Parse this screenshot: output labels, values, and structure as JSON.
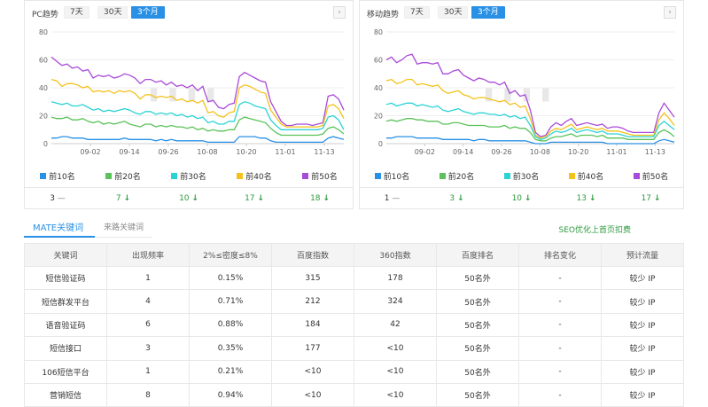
{
  "colors": {
    "accent": "#2a90e5",
    "green": "#2c9a3c",
    "series": [
      "#2a90e5",
      "#5ac25a",
      "#2cd3d6",
      "#f4c21b",
      "#a94bd9"
    ]
  },
  "pc": {
    "title": "PC趋势",
    "ranges": [
      "7天",
      "30天",
      "3个月"
    ],
    "legend": [
      "前10名",
      "前20名",
      "前30名",
      "前40名",
      "前50名"
    ],
    "counts": [
      {
        "value": "3",
        "trend": "flat"
      },
      {
        "value": "7",
        "trend": "down"
      },
      {
        "value": "10",
        "trend": "down"
      },
      {
        "value": "17",
        "trend": "down"
      },
      {
        "value": "18",
        "trend": "down"
      }
    ]
  },
  "mobile": {
    "title": "移动趋势",
    "ranges": [
      "7天",
      "30天",
      "3个月"
    ],
    "legend": [
      "前10名",
      "前20名",
      "前30名",
      "前40名",
      "前50名"
    ],
    "counts": [
      {
        "value": "1",
        "trend": "flat"
      },
      {
        "value": "3",
        "trend": "down"
      },
      {
        "value": "10",
        "trend": "down"
      },
      {
        "value": "13",
        "trend": "down"
      },
      {
        "value": "17",
        "trend": "down"
      }
    ]
  },
  "icons": {
    "flat": "—",
    "down": "↓",
    "next": "›"
  },
  "tabs": {
    "mate": "MATE关键词",
    "source": "来路关键词",
    "seo_link": "SEO优化上首页扣费"
  },
  "table": {
    "headers": [
      "关键词",
      "出现频率",
      "2%≤密度≤8%",
      "百度指数",
      "360指数",
      "百度排名",
      "排名变化",
      "预计流量"
    ],
    "rows": [
      [
        "短信验证码",
        "1",
        "0.15%",
        "315",
        "178",
        "50名外",
        "-",
        "较少 IP"
      ],
      [
        "短信群发平台",
        "4",
        "0.71%",
        "212",
        "324",
        "50名外",
        "-",
        "较少 IP"
      ],
      [
        "语音验证码",
        "6",
        "0.88%",
        "184",
        "42",
        "50名外",
        "-",
        "较少 IP"
      ],
      [
        "短信接口",
        "3",
        "0.35%",
        "177",
        "<10",
        "50名外",
        "-",
        "较少 IP"
      ],
      [
        "106短信平台",
        "1",
        "0.21%",
        "<10",
        "<10",
        "50名外",
        "-",
        "较少 IP"
      ],
      [
        "营销短信",
        "8",
        "0.94%",
        "<10",
        "<10",
        "50名外",
        "-",
        "较少 IP"
      ]
    ]
  },
  "chart_data": [
    {
      "type": "line",
      "x_ticks": [
        "09-02",
        "09-14",
        "09-26",
        "10-08",
        "10-20",
        "11-01",
        "11-13"
      ],
      "y_ticks": [
        "0",
        "20",
        "40",
        "60",
        "80"
      ],
      "ylim": [
        0,
        80
      ],
      "grid": true,
      "legend_position": "bottom",
      "series": [
        {
          "name": "前50名",
          "values": [
            62,
            59,
            56,
            57,
            54,
            55,
            52,
            53,
            47,
            49,
            48,
            49,
            47,
            48,
            50,
            49,
            47,
            43,
            46,
            46,
            44,
            45,
            42,
            44,
            41,
            42,
            40,
            42,
            38,
            41,
            30,
            31,
            26,
            25,
            28,
            29,
            48,
            51,
            49,
            47,
            45,
            44,
            30,
            23,
            16,
            13,
            13,
            14,
            14,
            14,
            13,
            14,
            15,
            34,
            35,
            32,
            24
          ]
        },
        {
          "name": "前40名",
          "values": [
            46,
            45,
            41,
            43,
            43,
            42,
            40,
            41,
            37,
            38,
            37,
            38,
            36,
            38,
            37,
            38,
            36,
            32,
            35,
            35,
            33,
            34,
            33,
            34,
            31,
            32,
            30,
            31,
            29,
            31,
            22,
            23,
            20,
            19,
            22,
            23,
            40,
            42,
            41,
            39,
            37,
            36,
            24,
            19,
            14,
            12,
            12,
            12,
            12,
            12,
            12,
            12,
            13,
            27,
            28,
            25,
            18
          ]
        },
        {
          "name": "前30名",
          "values": [
            30,
            29,
            28,
            29,
            27,
            27,
            28,
            26,
            24,
            25,
            23,
            24,
            23,
            24,
            25,
            24,
            22,
            21,
            23,
            23,
            21,
            22,
            21,
            22,
            20,
            21,
            19,
            20,
            18,
            19,
            15,
            16,
            14,
            14,
            16,
            16,
            28,
            30,
            29,
            27,
            26,
            25,
            17,
            13,
            10,
            10,
            10,
            10,
            10,
            10,
            10,
            10,
            11,
            19,
            20,
            17,
            10
          ]
        },
        {
          "name": "前20名",
          "values": [
            19,
            18,
            18,
            19,
            17,
            17,
            18,
            16,
            15,
            16,
            14,
            15,
            14,
            15,
            16,
            14,
            13,
            12,
            14,
            14,
            12,
            13,
            12,
            13,
            12,
            12,
            11,
            12,
            10,
            11,
            9,
            10,
            9,
            9,
            10,
            10,
            17,
            19,
            18,
            17,
            16,
            15,
            11,
            8,
            6,
            6,
            6,
            6,
            6,
            6,
            6,
            6,
            7,
            11,
            12,
            10,
            7
          ]
        },
        {
          "name": "前10名",
          "values": [
            4,
            4,
            5,
            5,
            4,
            4,
            4,
            3,
            3,
            3,
            3,
            3,
            3,
            3,
            4,
            3,
            3,
            3,
            3,
            3,
            2,
            3,
            2,
            3,
            2,
            2,
            2,
            2,
            2,
            2,
            1,
            1,
            1,
            1,
            1,
            1,
            5,
            5,
            5,
            5,
            4,
            4,
            2,
            1,
            1,
            1,
            1,
            1,
            1,
            1,
            1,
            1,
            1,
            4,
            5,
            4,
            3
          ]
        }
      ]
    },
    {
      "type": "line",
      "x_ticks": [
        "09-02",
        "09-14",
        "09-26",
        "10-08",
        "10-20",
        "11-01",
        "11-13"
      ],
      "y_ticks": [
        "0",
        "20",
        "40",
        "60",
        "80"
      ],
      "ylim": [
        0,
        80
      ],
      "grid": true,
      "legend_position": "bottom",
      "series": [
        {
          "name": "前50名",
          "values": [
            60,
            62,
            58,
            60,
            63,
            64,
            57,
            58,
            58,
            57,
            58,
            50,
            50,
            52,
            53,
            49,
            47,
            45,
            47,
            46,
            44,
            44,
            42,
            44,
            36,
            38,
            34,
            35,
            24,
            8,
            5,
            6,
            12,
            15,
            13,
            16,
            18,
            13,
            14,
            15,
            14,
            13,
            14,
            11,
            12,
            12,
            11,
            9,
            8,
            8,
            8,
            8,
            8,
            22,
            29,
            24,
            19
          ]
        },
        {
          "name": "前40名",
          "values": [
            45,
            46,
            43,
            44,
            46,
            46,
            42,
            43,
            42,
            41,
            42,
            38,
            36,
            37,
            38,
            35,
            34,
            32,
            33,
            33,
            32,
            31,
            30,
            31,
            28,
            29,
            26,
            27,
            18,
            6,
            4,
            5,
            9,
            11,
            10,
            12,
            14,
            10,
            11,
            12,
            11,
            10,
            11,
            9,
            9,
            9,
            8,
            7,
            6,
            6,
            6,
            6,
            6,
            17,
            22,
            18,
            13
          ]
        },
        {
          "name": "前30名",
          "values": [
            28,
            29,
            27,
            28,
            29,
            29,
            27,
            28,
            27,
            26,
            27,
            24,
            23,
            24,
            25,
            23,
            22,
            21,
            22,
            22,
            21,
            21,
            20,
            21,
            19,
            20,
            18,
            19,
            13,
            5,
            3,
            4,
            7,
            9,
            8,
            9,
            11,
            8,
            9,
            10,
            9,
            8,
            9,
            7,
            7,
            7,
            6,
            5,
            5,
            5,
            5,
            5,
            5,
            13,
            16,
            13,
            10
          ]
        },
        {
          "name": "前20名",
          "values": [
            16,
            17,
            16,
            17,
            18,
            18,
            17,
            17,
            16,
            16,
            16,
            14,
            14,
            15,
            15,
            14,
            13,
            13,
            13,
            13,
            12,
            12,
            12,
            13,
            11,
            12,
            11,
            11,
            8,
            3,
            2,
            2,
            4,
            5,
            5,
            6,
            7,
            5,
            6,
            6,
            6,
            5,
            6,
            4,
            4,
            4,
            4,
            3,
            3,
            3,
            3,
            3,
            3,
            8,
            10,
            8,
            5
          ]
        },
        {
          "name": "前10名",
          "values": [
            4,
            4,
            5,
            5,
            5,
            5,
            4,
            4,
            4,
            4,
            4,
            3,
            3,
            3,
            3,
            3,
            3,
            2,
            3,
            3,
            2,
            2,
            2,
            2,
            2,
            2,
            2,
            2,
            1,
            0,
            0,
            0,
            1,
            1,
            1,
            1,
            1,
            1,
            1,
            1,
            1,
            1,
            1,
            0,
            0,
            0,
            0,
            0,
            0,
            0,
            0,
            0,
            0,
            2,
            3,
            2,
            1
          ]
        }
      ]
    }
  ]
}
